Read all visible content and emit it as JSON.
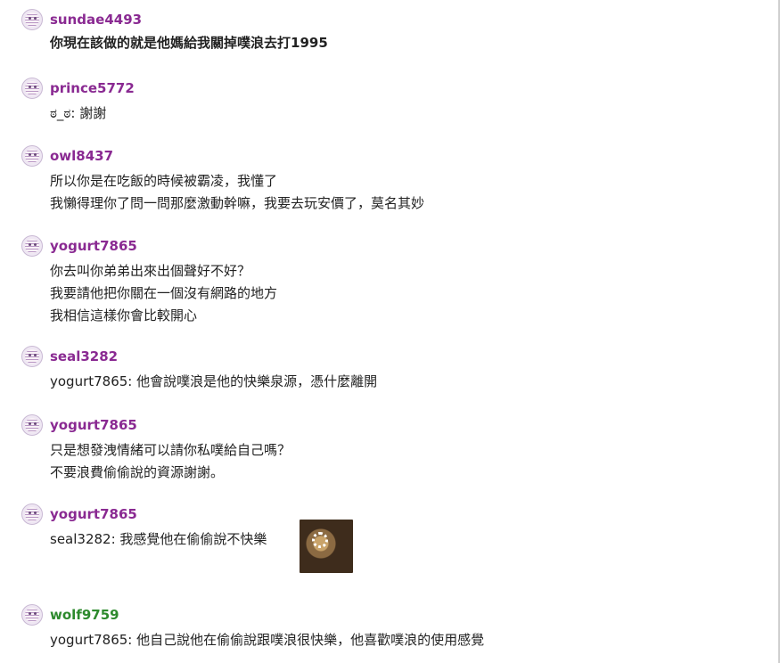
{
  "responses": [
    {
      "username": "sundae4493",
      "lines": [
        "你現在該做的就是他媽給我關掉噗浪去打1995"
      ]
    },
    {
      "username": "prince5772",
      "lines": [
        "ಠ_ಠ: 謝謝"
      ]
    },
    {
      "username": "owl8437",
      "lines": [
        "所以你是在吃飯的時候被霸凌，我懂了",
        "我懶得理你了問一問那麼激動幹嘛，我要去玩安價了，莫名其妙"
      ]
    },
    {
      "username": "yogurt7865",
      "lines": [
        "你去叫你弟弟出來出個聲好不好？",
        "我要請他把你關在一個沒有網路的地方",
        "我相信這樣你會比較開心"
      ]
    },
    {
      "username": "seal3282",
      "lines": [
        "yogurt7865: 他會說噗浪是他的快樂泉源，憑什麼離開"
      ]
    },
    {
      "username": "yogurt7865",
      "lines": [
        "只是想發洩情緒可以請你私噗給自己嗎？",
        "不要浪費偷偷說的資源謝謝。"
      ]
    },
    {
      "username": "yogurt7865",
      "lines": [
        "seal3282: 我感覺他在偷偷說不快樂"
      ]
    },
    {
      "username": "wolf9759",
      "lines": [
        "yogurt7865: 他自己說他在偷偷說跟噗浪很快樂，他喜歡噗浪的使用感覺"
      ]
    }
  ],
  "colors": {
    "username_default": "#8a2a92",
    "username_wolf": "#2d8a2d"
  }
}
